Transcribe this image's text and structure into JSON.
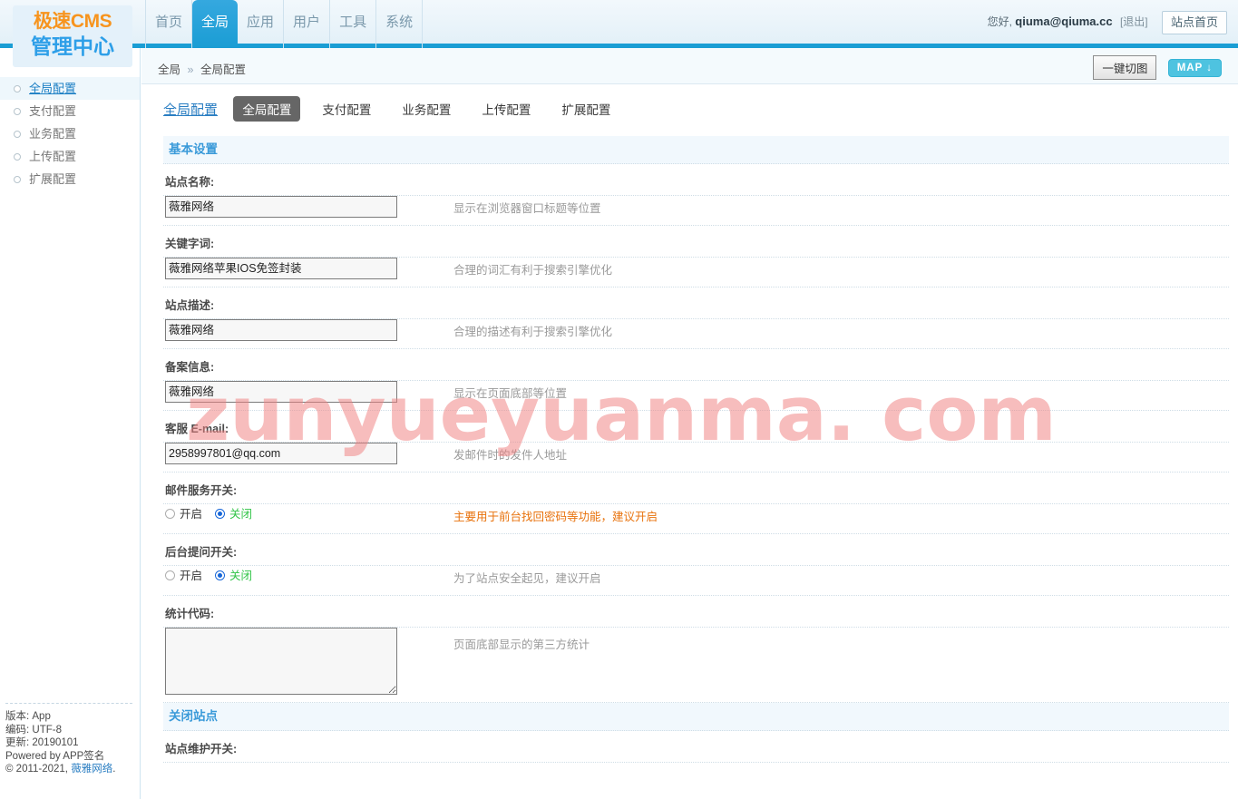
{
  "header": {
    "logo_line1": "极速CMS",
    "logo_line2": "管理中心",
    "nav": [
      {
        "label": "首页",
        "active": false
      },
      {
        "label": "全局",
        "active": true
      },
      {
        "label": "应用",
        "active": false
      },
      {
        "label": "用户",
        "active": false
      },
      {
        "label": "工具",
        "active": false
      },
      {
        "label": "系统",
        "active": false
      }
    ],
    "greeting": "您好,",
    "username": "qiuma@qiuma.cc",
    "logout": "[退出]",
    "site_home": "站点首页"
  },
  "breadcrumb": {
    "parent": "全局",
    "separator": "»",
    "current": "全局配置",
    "switch_button": "一键切图",
    "map_button": "MAP ↓"
  },
  "sidebar": {
    "items": [
      {
        "label": "全局配置",
        "active": true
      },
      {
        "label": "支付配置",
        "active": false
      },
      {
        "label": "业务配置",
        "active": false
      },
      {
        "label": "上传配置",
        "active": false
      },
      {
        "label": "扩展配置",
        "active": false
      }
    ],
    "footer": {
      "version": "版本: App",
      "encoding": "编码: UTF-8",
      "update": "更新: 20190101",
      "powered": "Powered by APP签名",
      "copyright_pre": "© 2011-2021, ",
      "copyright_link": "薇雅网络",
      "copyright_post": "."
    }
  },
  "main": {
    "page_title": "全局配置",
    "tabs": [
      {
        "label": "全局配置",
        "active": true
      },
      {
        "label": "支付配置",
        "active": false
      },
      {
        "label": "业务配置",
        "active": false
      },
      {
        "label": "上传配置",
        "active": false
      },
      {
        "label": "扩展配置",
        "active": false
      }
    ],
    "sections": [
      {
        "title": "基本设置",
        "fields": [
          {
            "label": "站点名称:",
            "type": "text",
            "value": "薇雅网络",
            "hint": "显示在浏览器窗口标题等位置",
            "hint_style": "normal"
          },
          {
            "label": "关键字词:",
            "type": "text",
            "value": "薇雅网络苹果IOS免签封装",
            "hint": "合理的词汇有利于搜索引擎优化",
            "hint_style": "normal"
          },
          {
            "label": "站点描述:",
            "type": "text",
            "value": "薇雅网络",
            "hint": "合理的描述有利于搜索引擎优化",
            "hint_style": "normal"
          },
          {
            "label": "备案信息:",
            "type": "text",
            "value": "薇雅网络",
            "hint": "显示在页面底部等位置",
            "hint_style": "normal"
          },
          {
            "label": "客服 E-mail:",
            "type": "text",
            "value": "2958997801@qq.com",
            "hint": "发邮件时的发件人地址",
            "hint_style": "normal"
          },
          {
            "label": "邮件服务开关:",
            "type": "radio",
            "on_label": "开启",
            "off_label": "关闭",
            "selected": "off",
            "hint": "主要用于前台找回密码等功能，建议开启",
            "hint_style": "warn"
          },
          {
            "label": "后台提问开关:",
            "type": "radio",
            "on_label": "开启",
            "off_label": "关闭",
            "selected": "off",
            "hint": "为了站点安全起见，建议开启",
            "hint_style": "normal"
          },
          {
            "label": "统计代码:",
            "type": "textarea",
            "value": "",
            "hint": "页面底部显示的第三方统计",
            "hint_style": "normal"
          }
        ]
      },
      {
        "title": "关闭站点",
        "fields": [
          {
            "label": "站点维护开关:",
            "type": "label-only",
            "hint": "",
            "hint_style": "normal"
          }
        ]
      }
    ]
  },
  "watermark": {
    "text": "zunyueyuanma. com",
    "color": "#f08080"
  },
  "colors": {
    "accent_blue": "#1a9dd4",
    "logo_orange": "#f7941e",
    "logo_blue": "#2e9fe8",
    "section_title": "#3a9ad9",
    "warn_orange": "#e8720c",
    "radio_off_green": "#31c447",
    "map_cyan": "#4ec3e0"
  }
}
